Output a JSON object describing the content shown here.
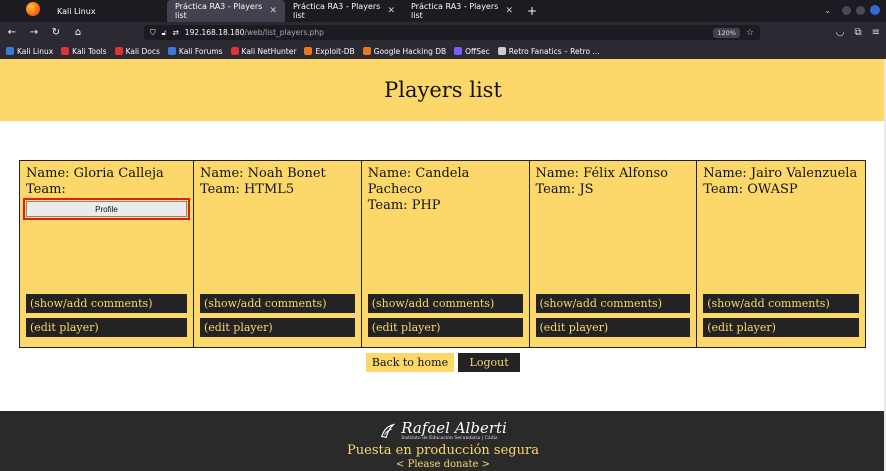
{
  "browser": {
    "tabs": [
      {
        "title": "Kali Linux",
        "active": false
      },
      {
        "title": "Práctica RA3 - Players list",
        "active": true
      },
      {
        "title": "Práctica RA3 - Players list",
        "active": false
      },
      {
        "title": "Práctica RA3 - Players list",
        "active": false
      }
    ],
    "url_host": "192.168.18.180",
    "url_path": "/web/list_players.php",
    "zoom": "120%",
    "bookmarks": [
      {
        "label": "Kali Linux",
        "color": "#3a7bd5"
      },
      {
        "label": "Kali Tools",
        "color": "#d33"
      },
      {
        "label": "Kali Docs",
        "color": "#d33"
      },
      {
        "label": "Kali Forums",
        "color": "#3a7bd5"
      },
      {
        "label": "Kali NetHunter",
        "color": "#d33"
      },
      {
        "label": "Exploit-DB",
        "color": "#e8781f"
      },
      {
        "label": "Google Hacking DB",
        "color": "#e8781f"
      },
      {
        "label": "OffSec",
        "color": "#7a5cff"
      },
      {
        "label": "Retro Fanatics – Retro ...",
        "color": "#cccccc"
      }
    ]
  },
  "page": {
    "title": "Players list",
    "players": [
      {
        "name": "Name: Gloria Calleja",
        "team": "Team:",
        "profile": "Profile"
      },
      {
        "name": "Name: Noah Bonet",
        "team": "Team: HTML5"
      },
      {
        "name": "Name: Candela Pacheco",
        "team": "Team: PHP"
      },
      {
        "name": "Name: Félix Alfonso",
        "team": "Team: JS"
      },
      {
        "name": "Name: Jairo Valenzuela",
        "team": "Team: OWASP"
      }
    ],
    "comments_label": "(show/add comments)",
    "edit_label": "(edit player)",
    "back_home": "Back to home",
    "logout": "Logout"
  },
  "footer": {
    "logo_name": "Rafael Alberti",
    "logo_sub": "Instituto de Educación Secundaria | Cádiz",
    "tagline": "Puesta en producción segura",
    "donate": "< Please donate >"
  },
  "colors": {
    "accent": "#fcd86a",
    "dark": "#232323",
    "highlight": "#d9221c"
  }
}
